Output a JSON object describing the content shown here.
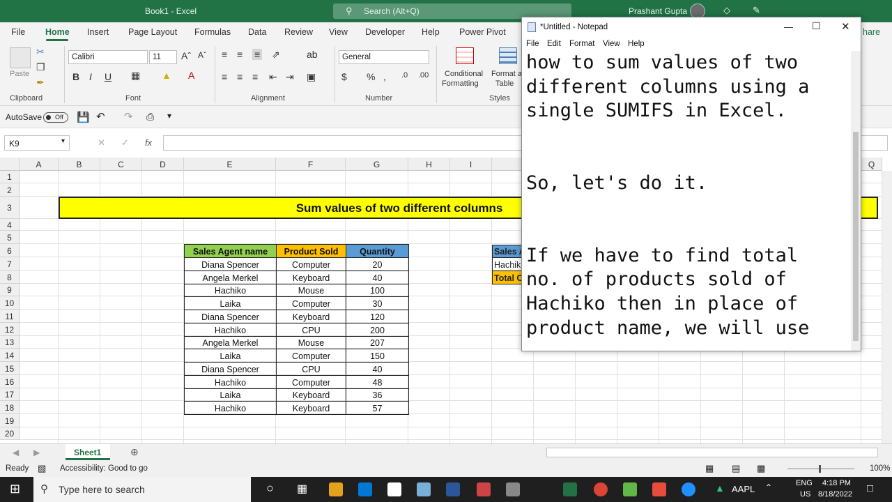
{
  "window": {
    "title": "Book1  -  Excel",
    "search_placeholder": "Search (Alt+Q)",
    "user": "Prashant Gupta"
  },
  "menu": [
    "File",
    "Home",
    "Insert",
    "Page Layout",
    "Formulas",
    "Data",
    "Review",
    "View",
    "Developer",
    "Help",
    "Power Pivot"
  ],
  "menu_share": "hare",
  "ribbon": {
    "paste": "Paste",
    "clipboard": "Clipboard",
    "font_name": "Calibri",
    "font_size": "11",
    "font_group": "Font",
    "alignment_group": "Alignment",
    "number_format": "General",
    "number_group": "Number",
    "conditional": "Conditional",
    "formatting": "Formatting",
    "format_as": "Format a",
    "table": "Table",
    "styles": "Styles",
    "bold": "B",
    "italic": "I",
    "underline": "U"
  },
  "qat": {
    "autosave": "AutoSave",
    "toggle": "Off"
  },
  "formula_bar": {
    "name_box": "K9",
    "fx": "fx"
  },
  "columns": [
    "A",
    "B",
    "C",
    "D",
    "E",
    "F",
    "G",
    "H",
    "I",
    "",
    "",
    "",
    "",
    "",
    "",
    "",
    "",
    "Q"
  ],
  "rows": [
    "1",
    "2",
    "3",
    "4",
    "5",
    "6",
    "7",
    "8",
    "9",
    "10",
    "11",
    "12",
    "13",
    "14",
    "15",
    "16",
    "17",
    "18",
    "19",
    "20"
  ],
  "banner": "Sum values of two different columns",
  "table": {
    "headers": [
      "Sales Agent name",
      "Product Sold",
      "Quantity"
    ],
    "rows": [
      [
        "Diana Spencer",
        "Computer",
        "20"
      ],
      [
        "Angela Merkel",
        "Keyboard",
        "40"
      ],
      [
        "Hachiko",
        "Mouse",
        "100"
      ],
      [
        "Laika",
        "Computer",
        "30"
      ],
      [
        "Diana Spencer",
        "Keyboard",
        "120"
      ],
      [
        "Hachiko",
        "CPU",
        "200"
      ],
      [
        "Angela Merkel",
        "Mouse",
        "207"
      ],
      [
        "Laika",
        "Computer",
        "150"
      ],
      [
        "Diana Spencer",
        "CPU",
        "40"
      ],
      [
        "Hachiko",
        "Computer",
        "48"
      ],
      [
        "Laika",
        "Keyboard",
        "36"
      ],
      [
        "Hachiko",
        "Keyboard",
        "57"
      ]
    ]
  },
  "side_table": {
    "header": "Sales A",
    "row1": "Hachik",
    "row2": "Total C"
  },
  "sheet_tab": "Sheet1",
  "status": {
    "ready": "Ready",
    "accessibility": "Accessibility: Good to go",
    "zoom": "100%"
  },
  "notepad": {
    "title": "*Untitled - Notepad",
    "menu": [
      "File",
      "Edit",
      "Format",
      "View",
      "Help"
    ],
    "lines": [
      "how to sum values of two",
      "different columns using a",
      "single SUMIFS in Excel.",
      "",
      "",
      "So, let's do it.",
      "",
      "",
      "If we have to find total",
      "no. of products sold of",
      "Hachiko then in place of",
      "product name, we will use"
    ]
  },
  "taskbar": {
    "search": "Type here to search",
    "stock": "AAPL",
    "lang1": "ENG",
    "lang2": "US",
    "time": "4:18 PM",
    "date": "8/18/2022"
  },
  "colors": {
    "excel_green": "#217346",
    "banner_yellow": "#FFFF00",
    "header_green": "#92D050",
    "header_orange": "#FFC000",
    "header_blue": "#5B9BD5"
  }
}
